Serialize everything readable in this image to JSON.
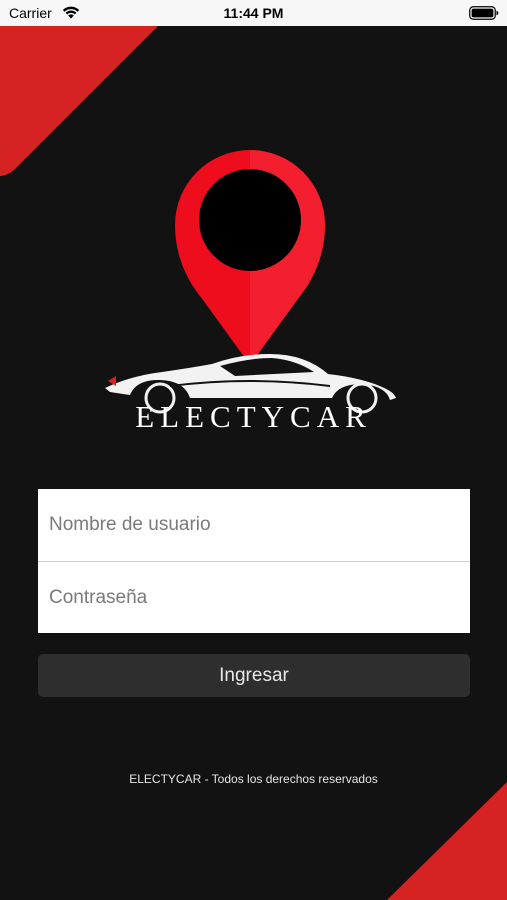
{
  "status_bar": {
    "carrier": "Carrier",
    "time": "11:44 PM",
    "wifi_icon": "wifi-icon",
    "battery_icon": "battery-icon"
  },
  "theme": {
    "background": "#121212",
    "accent": "#d62222",
    "button_bg": "#2e2e2e"
  },
  "logo": {
    "icon": "location-pin-car-icon",
    "brand": "ELECTYCAR"
  },
  "login_form": {
    "username_placeholder": "Nombre de usuario",
    "username_value": "",
    "password_placeholder": "Contraseña",
    "password_value": "",
    "submit_label": "Ingresar"
  },
  "footer": {
    "text": "ELECTYCAR - Todos los derechos reservados"
  }
}
